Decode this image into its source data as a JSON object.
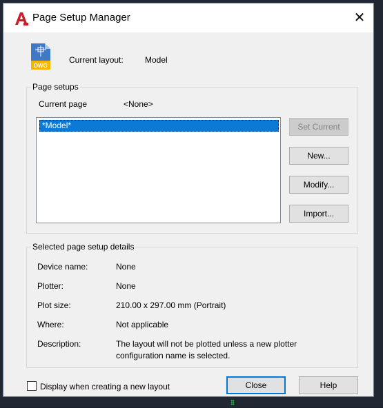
{
  "window": {
    "title": "Page Setup Manager",
    "close_symbol": "✕"
  },
  "layout": {
    "current_layout_label": "Current layout:",
    "current_layout_value": "Model",
    "file_icon_label": "DWG"
  },
  "page_setups": {
    "group_label": "Page setups",
    "current_page_label": "Current page",
    "current_page_value": "<None>",
    "items": [
      "*Model*"
    ],
    "buttons": {
      "set_current": "Set Current",
      "new": "New...",
      "modify": "Modify...",
      "import": "Import..."
    }
  },
  "details": {
    "group_label": "Selected page setup details",
    "rows": [
      {
        "label": "Device name:",
        "value": "None"
      },
      {
        "label": "Plotter:",
        "value": "None"
      },
      {
        "label": "Plot size:",
        "value": "210.00 x 297.00 mm (Portrait)"
      },
      {
        "label": "Where:",
        "value": "Not applicable"
      },
      {
        "label": "Description:",
        "value": "The layout will not be plotted unless a new plotter"
      },
      {
        "label": "",
        "value": "configuration name is selected."
      }
    ]
  },
  "footer": {
    "checkbox_label": "Display when creating a new layout",
    "checkbox_checked": false,
    "close_label": "Close",
    "help_label": "Help"
  },
  "colors": {
    "selection": "#0a7ad6",
    "default_button_border": "#0078d7",
    "autocad_red": "#c8202b",
    "dwg_yellow": "#f3b700"
  }
}
